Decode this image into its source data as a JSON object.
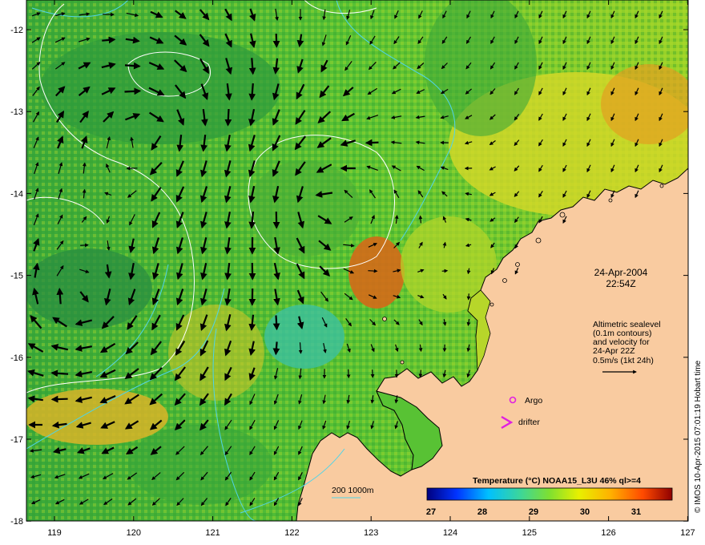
{
  "map": {
    "x_ticks": [
      "119",
      "120",
      "121",
      "122",
      "123",
      "124",
      "125",
      "126",
      "127"
    ],
    "y_ticks": [
      "-12",
      "-13",
      "-14",
      "-15",
      "-16",
      "-17",
      "-18"
    ],
    "date": "24-Apr-2004",
    "time": "22:54Z",
    "info_lines": [
      "Altimetric sealevel",
      "(0.1m contours)",
      "and velocity for",
      "24-Apr 22Z",
      "0.5m/s (1kt 24h)"
    ],
    "legend_argo": "Argo",
    "legend_drifter": "drifter",
    "bathy_label": "200  1000m",
    "colorbar_title": "Temperature (°C) NOAA15_L3U 46% ql>=4",
    "colorbar_ticks": [
      "27",
      "28",
      "29",
      "30",
      "31"
    ],
    "credit": "© IMOS 10-Apr-2015 07:01:19 Hobart time"
  },
  "colors": {
    "land": "#F9CBA0",
    "bathy_contour": "#4FD4E8",
    "argo": "#E020E0",
    "coast": "#000000"
  }
}
